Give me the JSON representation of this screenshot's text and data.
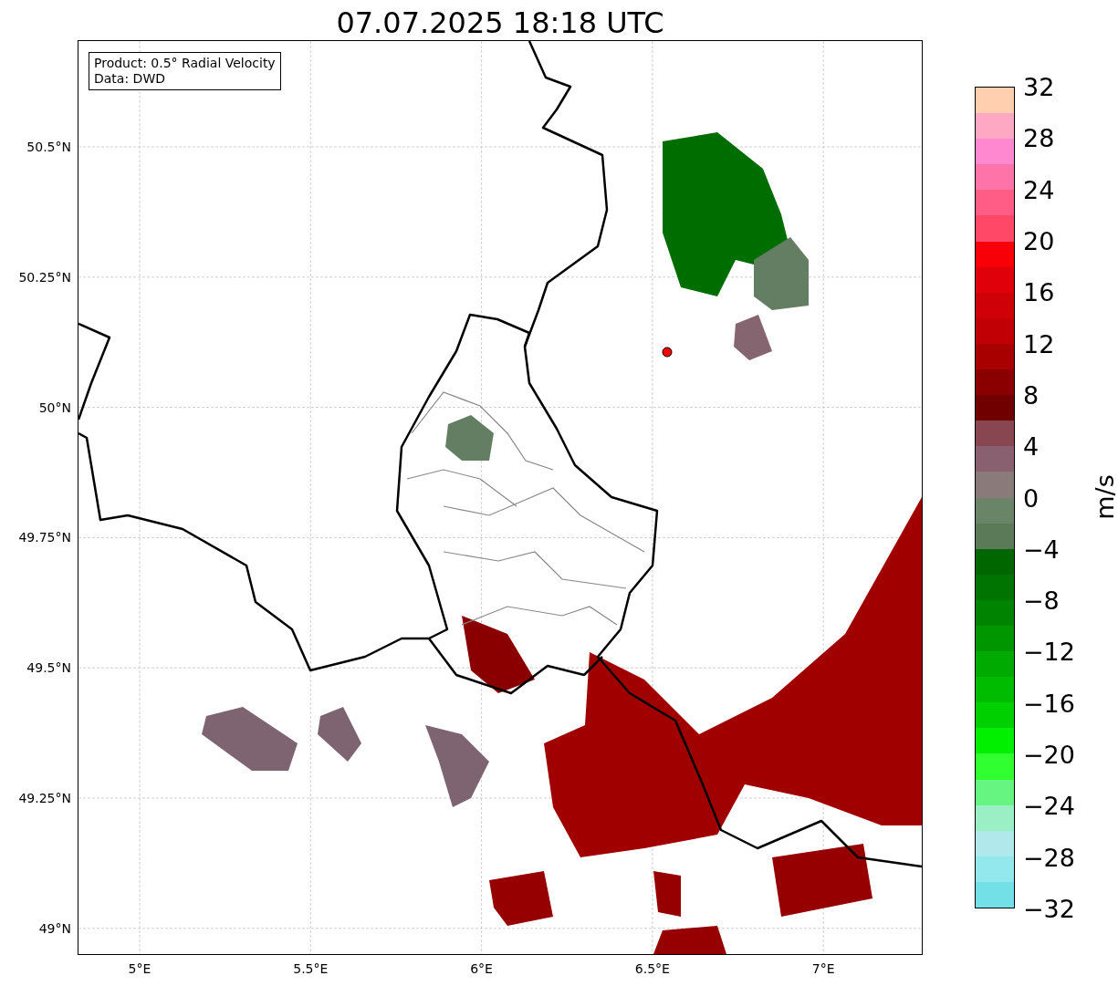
{
  "title": "07.07.2025 18:18 UTC",
  "map": {
    "legend": [
      "Product: 0.5° Radial Velocity",
      "Data: DWD"
    ],
    "yticks": [
      "50.5°N",
      "50.25°N",
      "50°N",
      "49.75°N",
      "49.5°N",
      "49.25°N",
      "49°N"
    ],
    "xticks": [
      "5°E",
      "5.5°E",
      "6°E",
      "6.5°E",
      "7°E"
    ]
  },
  "colorbar": {
    "label": "m/s",
    "ticks": [
      "32",
      "28",
      "24",
      "20",
      "16",
      "12",
      "8",
      "4",
      "0",
      "−4",
      "−8",
      "−12",
      "−16",
      "−20",
      "−24",
      "−28",
      "−32"
    ],
    "segments": [
      {
        "color": "#ffcfb0"
      },
      {
        "color": "#ffa8c4"
      },
      {
        "color": "#ff88d0"
      },
      {
        "color": "#ff74a8"
      },
      {
        "color": "#ff5c86"
      },
      {
        "color": "#ff4868"
      },
      {
        "color": "#f80008"
      },
      {
        "color": "#e0000a"
      },
      {
        "color": "#d00008"
      },
      {
        "color": "#c00004"
      },
      {
        "color": "#a80000"
      },
      {
        "color": "#8a0000"
      },
      {
        "color": "#700000"
      },
      {
        "color": "#884650"
      },
      {
        "color": "#886070"
      },
      {
        "color": "#8a7a7a"
      },
      {
        "color": "#6a8468"
      },
      {
        "color": "#5a7a58"
      },
      {
        "color": "#006600"
      },
      {
        "color": "#007400"
      },
      {
        "color": "#008400"
      },
      {
        "color": "#009600"
      },
      {
        "color": "#00aa00"
      },
      {
        "color": "#00bc00"
      },
      {
        "color": "#00d000"
      },
      {
        "color": "#00f000"
      },
      {
        "color": "#30ff30"
      },
      {
        "color": "#66f580"
      },
      {
        "color": "#9af0c4"
      },
      {
        "color": "#b0e8ec"
      },
      {
        "color": "#92e8ec"
      },
      {
        "color": "#72e0e6"
      }
    ]
  }
}
